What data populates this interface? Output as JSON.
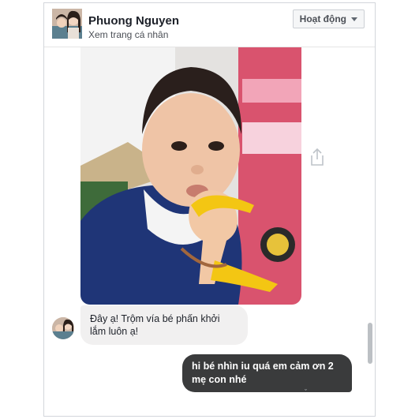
{
  "header": {
    "contact_name": "Phuong Nguyen",
    "profile_link": "Xem trang cá nhân",
    "status_button": "Hoạt động",
    "status_icon": "chevron-down-icon"
  },
  "messages": {
    "incoming_text": "Đây ạ! Trộm vía bé phấn khởi lắm luôn ạ!",
    "outgoing_text": "hi bé nhìn iu quá em cảm ơn 2 mẹ con nhé",
    "read_marker": "ˇ"
  },
  "colors": {
    "incoming_bubble": "#f1f0f0",
    "outgoing_bubble": "#3a3b3c",
    "border": "#d3d6db"
  },
  "icons": {
    "share": "share-icon",
    "avatar": "avatar"
  }
}
